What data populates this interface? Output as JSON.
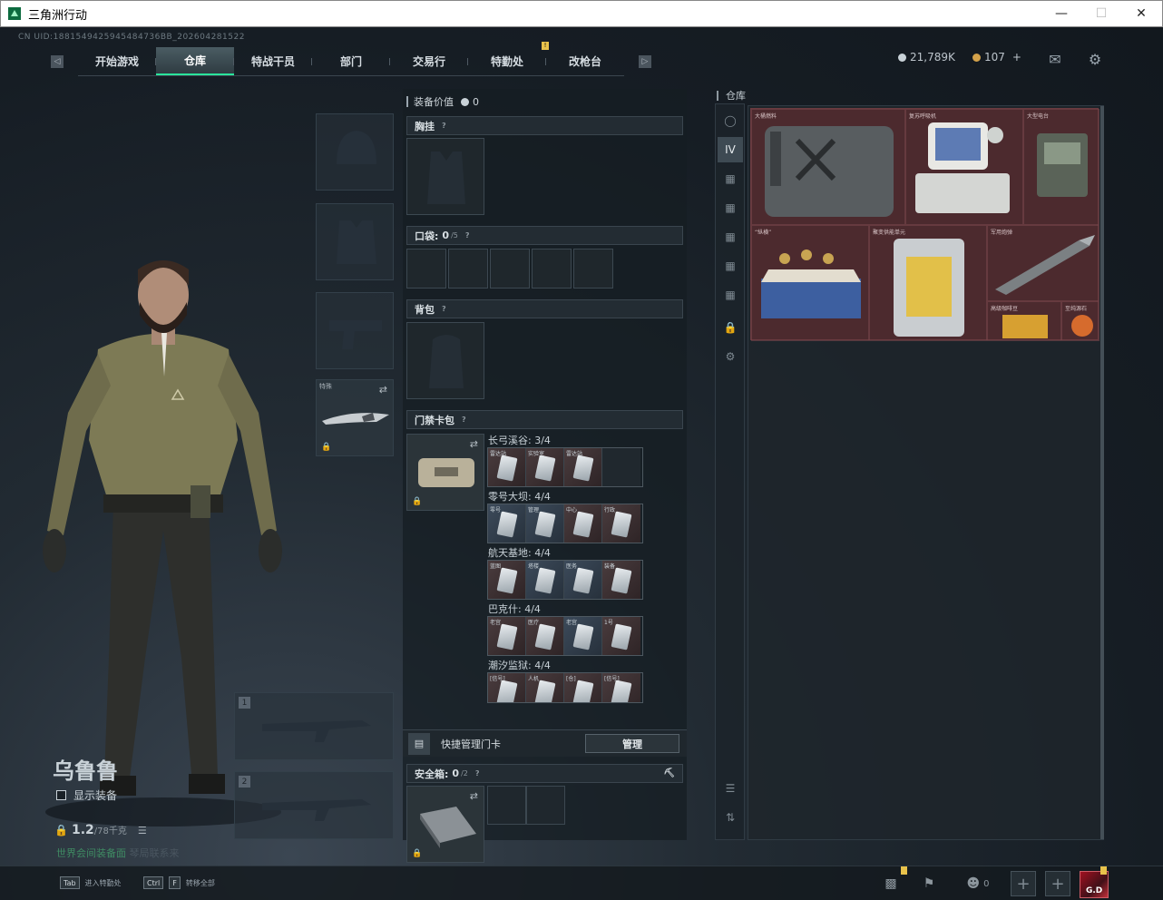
{
  "window": {
    "title": "三角洲行动"
  },
  "uid": "CN UID:1881549425945484736BB_202604281522",
  "nav": {
    "tabs": [
      "开始游戏",
      "仓库",
      "特战干员",
      "部门",
      "交易行",
      "特勤处",
      "改枪台"
    ],
    "active_index": 1
  },
  "currency": {
    "coins": "21,789K",
    "tickets": "107"
  },
  "character": {
    "name": "乌鲁鲁",
    "show_equipment_label": "显示装备",
    "weight_value": "1.2",
    "weight_max": "/78千克",
    "marquee_highlight": "世界会间装备面",
    "marquee_rest": "琴局联系来"
  },
  "slots": {
    "melee_tag": "特殊",
    "weapon1_num": "1",
    "weapon2_num": "2"
  },
  "mid": {
    "value_label": "装备价值",
    "value_amount": "0",
    "chest_label": "胸挂",
    "pocket_label": "口袋:",
    "pocket_count": "0",
    "pocket_max": "/5",
    "backpack_label": "背包",
    "keycard_label": "门禁卡包",
    "keycard_groups": [
      {
        "title": "长弓溪谷: 3/4",
        "cards": [
          "雷达站",
          "实验室",
          "雷达站",
          ""
        ]
      },
      {
        "title": "零号大坝: 4/4",
        "cards": [
          "零号",
          "管理",
          "中心",
          "行政"
        ]
      },
      {
        "title": "航天基地: 4/4",
        "cards": [
          "蓝图",
          "塔楼",
          "医务",
          "装备"
        ]
      },
      {
        "title": "巴克什: 4/4",
        "cards": [
          "老宫",
          "医疗",
          "老宫",
          "1号"
        ]
      },
      {
        "title": "潮汐监狱: 4/4",
        "cards": [
          "[信号]",
          "人机",
          "[仓]",
          "[信号]"
        ]
      }
    ],
    "quick_manage_label": "快捷管理门卡",
    "manage_button": "管理",
    "safebox_label": "安全箱:",
    "safebox_count": "0",
    "safebox_max": "/2"
  },
  "warehouse": {
    "title": "仓库",
    "items": [
      {
        "name": "大桶燃料"
      },
      {
        "name": "复苏呼吸机"
      },
      {
        "name": "大型电台"
      },
      {
        "name": "“纵横”"
      },
      {
        "name": "聚变供能单元"
      },
      {
        "name": "军用炮弹"
      },
      {
        "name": "高级咖啡豆"
      },
      {
        "name": "至纯源石"
      }
    ]
  },
  "bottom": {
    "hint1_key": "Tab",
    "hint1_text": "进入特勤处",
    "hint2_key1": "Ctrl",
    "hint2_key2": "F",
    "hint2_text": "转移全部",
    "friends_count": "0",
    "avatar_label": "G.D"
  },
  "colors": {
    "accent": "#2ae59c",
    "warning": "#e8c24b",
    "rarity_red": "#4c2a2e"
  }
}
